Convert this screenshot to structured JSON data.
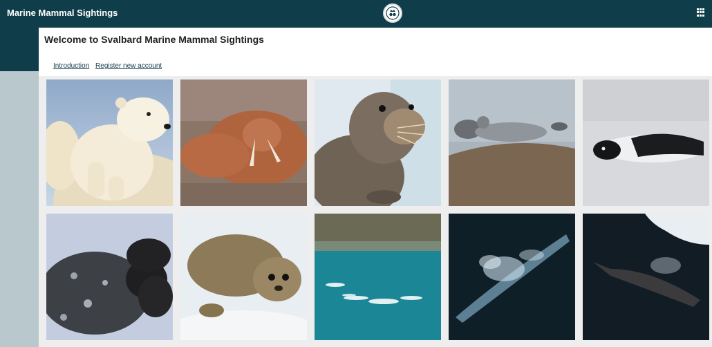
{
  "app": {
    "title": "Marine Mammal Sightings"
  },
  "header": {
    "crest_icon": "crest-logo-icon",
    "apps_icon": "apps-grid-icon"
  },
  "page": {
    "title": "Welcome to Svalbard Marine Mammal Sightings",
    "links": [
      {
        "label": "Introduction"
      },
      {
        "label": "Register new account"
      }
    ]
  },
  "gallery": {
    "photos": [
      {
        "subject": "polar bear cub"
      },
      {
        "subject": "walrus"
      },
      {
        "subject": "bearded seal"
      },
      {
        "subject": "seals on rock"
      },
      {
        "subject": "harp seal"
      },
      {
        "subject": "hooded seal"
      },
      {
        "subject": "ringed seal pup"
      },
      {
        "subject": "beluga whales"
      },
      {
        "subject": "blue whale"
      },
      {
        "subject": "bowhead whale"
      }
    ]
  },
  "colors": {
    "topbar": "#0f3d4a",
    "sidebar": "#b9c8cd",
    "link": "#18414d"
  }
}
